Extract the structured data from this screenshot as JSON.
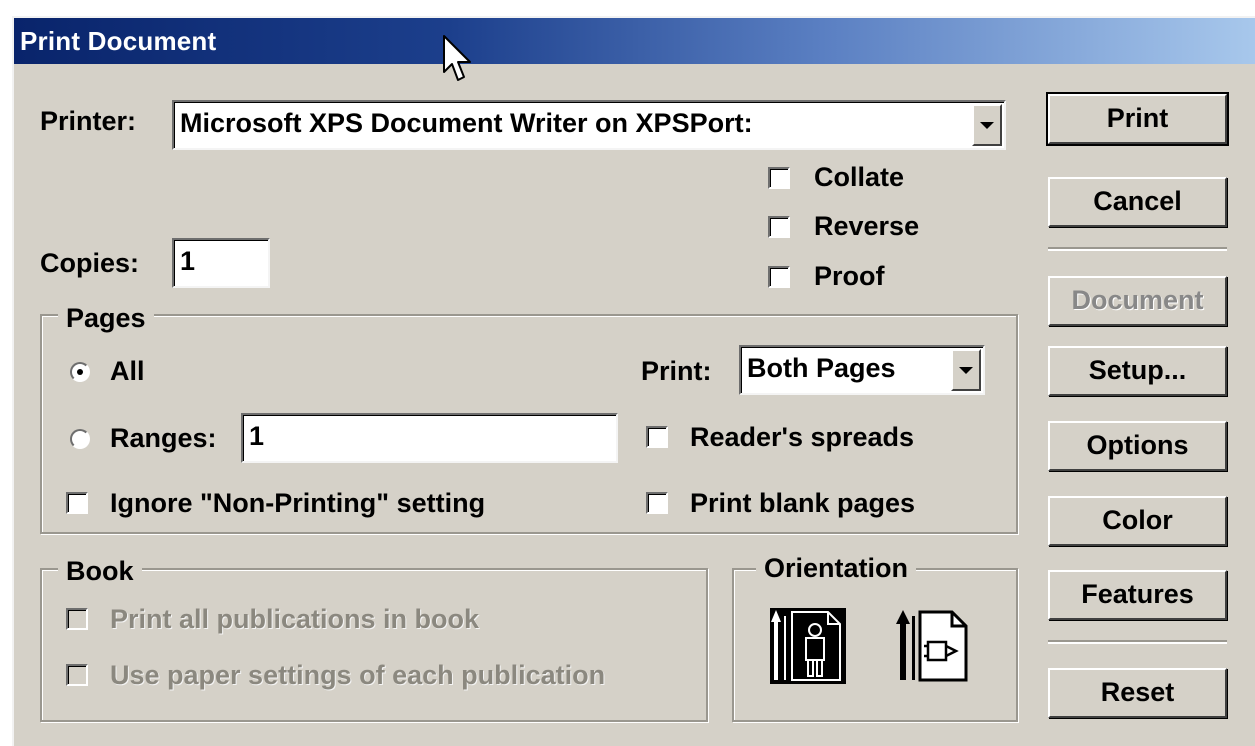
{
  "window": {
    "title": "Print Document"
  },
  "printer": {
    "label": "Printer:",
    "value": "Microsoft XPS Document Writer on XPSPort:"
  },
  "options": {
    "collate": {
      "label": "Collate",
      "checked": false
    },
    "reverse": {
      "label": "Reverse",
      "checked": false
    },
    "proof": {
      "label": "Proof",
      "checked": false
    }
  },
  "copies": {
    "label": "Copies:",
    "value": "1"
  },
  "pages": {
    "legend": "Pages",
    "all_label": "All",
    "ranges_label": "Ranges:",
    "ranges_value": "1",
    "selected": "All",
    "print_label": "Print:",
    "print_value": "Both Pages",
    "readers_spreads": "Reader's spreads",
    "ignore_nonprinting": "Ignore \"Non-Printing\" setting",
    "print_blank": "Print blank pages"
  },
  "book": {
    "legend": "Book",
    "print_all": "Print all publications in book",
    "use_paper": "Use paper settings of each publication"
  },
  "orientation": {
    "legend": "Orientation",
    "portrait_icon": "portrait-orientation-icon",
    "landscape_icon": "landscape-orientation-icon"
  },
  "buttons": {
    "print": "Print",
    "cancel": "Cancel",
    "document": "Document",
    "setup": "Setup...",
    "options": "Options",
    "color": "Color",
    "features": "Features",
    "reset": "Reset"
  },
  "colors": {
    "dialog_bg": "#d5d1c8",
    "titlebar_start": "#09246b",
    "titlebar_end": "#a8c8ec"
  }
}
